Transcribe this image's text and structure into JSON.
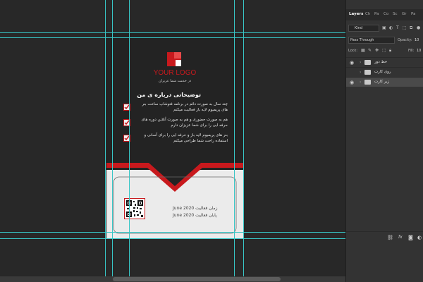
{
  "card": {
    "logo_text": "YOUR LOGO",
    "logo_subtitle": "در خدمت شما عزیزان",
    "about_title": "توضیحاتی درباره ی من",
    "items": [
      {
        "text": "چند سال به صورت دائم در برنامه فتوشاپ ساخت بنر های پریمیوم لایه باز فعالیت میکنم"
      },
      {
        "text": "هم به صورت حضوری و هم به صورت آنلاین دوره های حرفه ایی را برای شما عزیزان دارم"
      },
      {
        "text": "بنر های پریمیوم لایه باز و حرفه ایی را برای آسانی و استفاده راحت شما طراحی میکنم"
      }
    ],
    "date_rows": [
      {
        "date": "June 2020",
        "label": "زمان فعالیت"
      },
      {
        "date": "June 2020",
        "label": "پایان فعالیت"
      }
    ],
    "colors": {
      "accent": "#c8191d",
      "dark": "#232323",
      "light": "#ebebeb"
    }
  },
  "panel": {
    "tabs": [
      "Layers",
      "Ch",
      "Pa",
      "Co",
      "Sc",
      "Gr",
      "Pa"
    ],
    "filter_kind": "Kind",
    "blend_mode": "Pass Through",
    "opacity_label": "Opacity:",
    "opacity_value": "10",
    "lock_label": "Lock:",
    "fill_label": "Fill:",
    "fill_value": "10",
    "layers": [
      {
        "name": "خط دور",
        "visible": true,
        "selected": false
      },
      {
        "name": "روی کارت",
        "visible": false,
        "selected": false
      },
      {
        "name": "زیر کارت",
        "visible": true,
        "selected": true
      }
    ],
    "bottom_icons": [
      "link-icon",
      "fx-icon",
      "mask-icon"
    ]
  }
}
